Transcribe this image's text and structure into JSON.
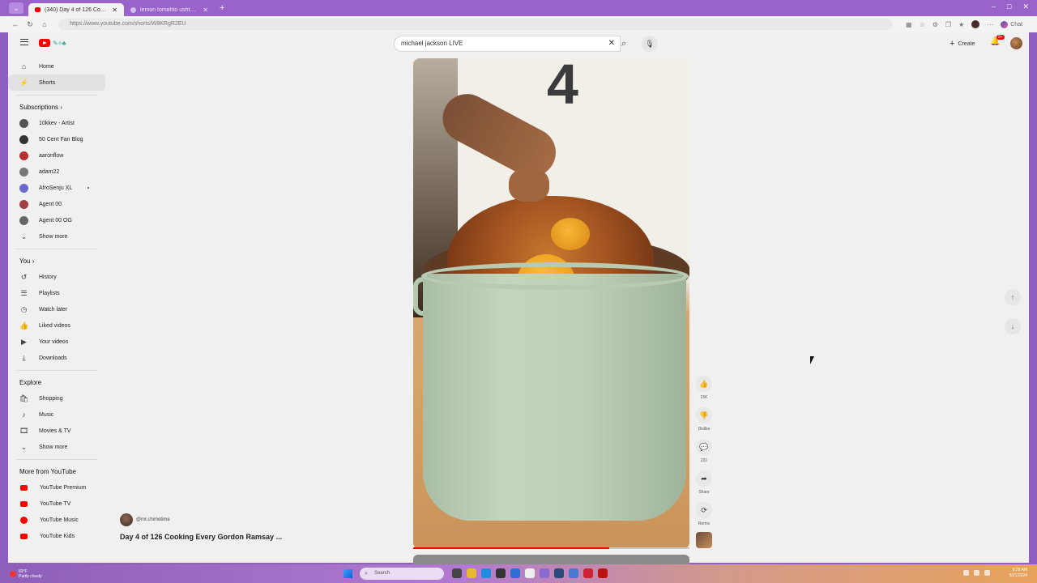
{
  "browser": {
    "tabs": [
      {
        "title": "(340) Day 4 of 126 Cooking E...",
        "active": true
      },
      {
        "title": "lemon tomahto ushtoon - Google",
        "active": false
      }
    ],
    "new_tab": "+",
    "url": "https://www.youtube.com/shorts/W8KRgR2EU",
    "window_controls": [
      "–",
      "□",
      "✕"
    ],
    "chat_label": "Chat"
  },
  "header": {
    "search_value": "michael jackson LIVE",
    "create_label": "Create",
    "notification_count": "9+"
  },
  "sidebar": {
    "main": [
      {
        "label": "Home",
        "icon": "home-icon",
        "glyph": "⌂"
      },
      {
        "label": "Shorts",
        "icon": "shorts-icon",
        "glyph": "⚡"
      }
    ],
    "subscriptions_header": "Subscriptions  ›",
    "subscriptions": [
      {
        "label": "10kkev - Artist",
        "color": "#555555"
      },
      {
        "label": "50 Cent Fan Blog",
        "color": "#333333"
      },
      {
        "label": "aaronflow",
        "color": "#b83030"
      },
      {
        "label": "adam22",
        "color": "#777777"
      },
      {
        "label": "AfroSenju XL",
        "color": "#6a6acc"
      },
      {
        "label": "Agent 00",
        "color": "#a04040"
      },
      {
        "label": "Agent 00 OG",
        "color": "#666666"
      }
    ],
    "subs_show_more": "Show more",
    "you_header": "You  ›",
    "you": [
      {
        "label": "History",
        "icon": "history-icon",
        "glyph": "↺"
      },
      {
        "label": "Playlists",
        "icon": "playlists-icon",
        "glyph": "☰"
      },
      {
        "label": "Watch later",
        "icon": "clock-icon",
        "glyph": "◷"
      },
      {
        "label": "Liked videos",
        "icon": "thumb-up-icon",
        "glyph": "👍"
      },
      {
        "label": "Your videos",
        "icon": "video-icon",
        "glyph": "▶"
      },
      {
        "label": "Downloads",
        "icon": "download-icon",
        "glyph": "⤓"
      }
    ],
    "explore_header": "Explore",
    "explore": [
      {
        "label": "Shopping",
        "icon": "shopping-icon",
        "glyph": "🛍"
      },
      {
        "label": "Music",
        "icon": "music-icon",
        "glyph": "♪"
      },
      {
        "label": "Movies & TV",
        "icon": "movies-icon",
        "glyph": "🎞"
      }
    ],
    "explore_show_more": "Show more",
    "more_header": "More from YouTube",
    "more": [
      {
        "label": "YouTube Premium"
      },
      {
        "label": "YouTube TV"
      },
      {
        "label": "YouTube Music"
      },
      {
        "label": "YouTube Kids"
      }
    ]
  },
  "video": {
    "channel": "@mr.chimetime",
    "title": "Day 4 of 126 Cooking Every Gordon Ramsay ...",
    "jersey_number": "4",
    "progress": 0.71
  },
  "actions": {
    "like_count": "15K",
    "dislike_label": "Dislike",
    "comment_count": "231",
    "share_label": "Share",
    "remix_label": "Remix"
  },
  "taskbar": {
    "weather_temp": "69°F",
    "weather_desc": "Partly cloudy",
    "search_placeholder": "Search",
    "time": "9:28 AM",
    "date": "5/21/2024"
  }
}
